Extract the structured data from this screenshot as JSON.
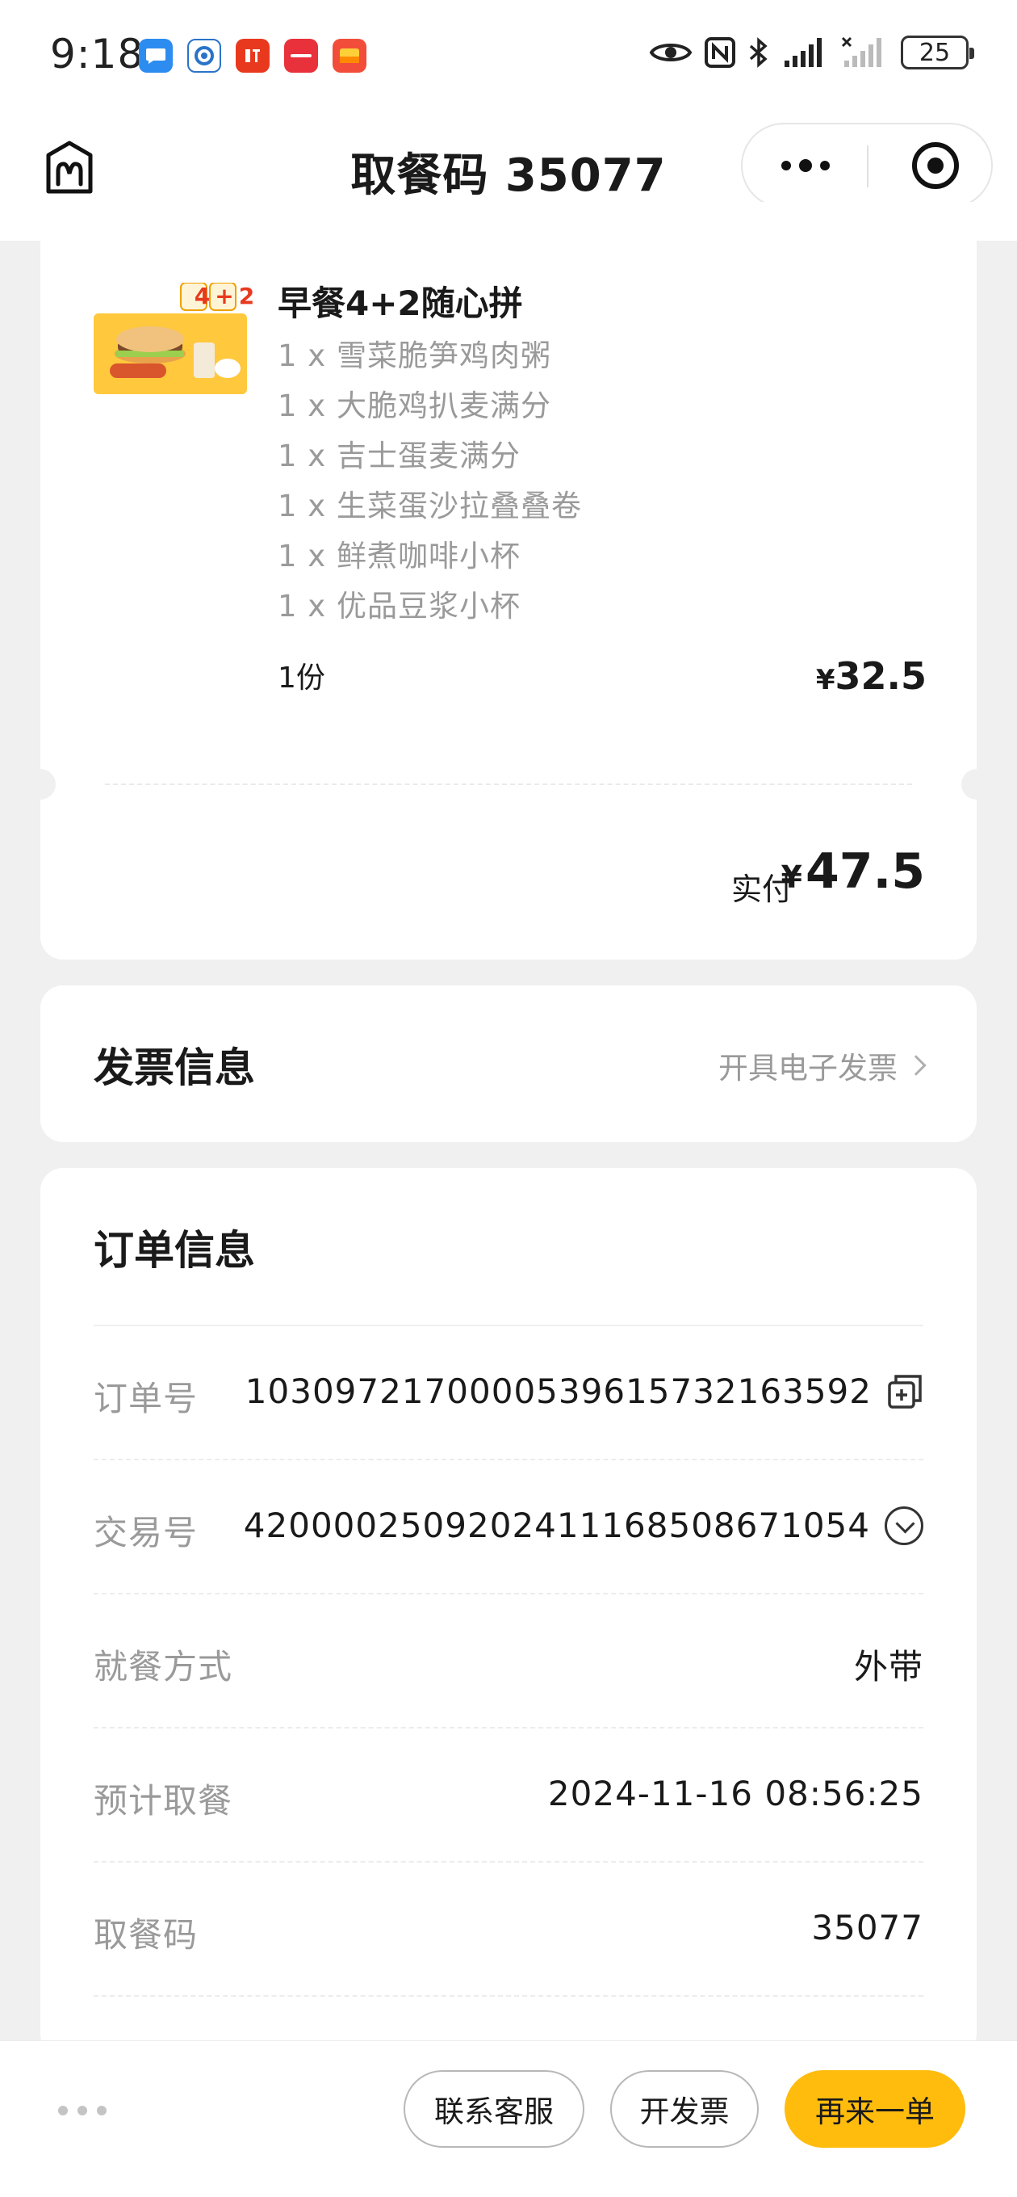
{
  "status_bar": {
    "time": "9:18",
    "battery": "25"
  },
  "nav": {
    "title": "取餐码 35077"
  },
  "item": {
    "name": "早餐4+2随心拼",
    "badge": "4+2",
    "sub_items": [
      "1 x 雪菜脆笋鸡肉粥",
      "1 x 大脆鸡扒麦满分",
      "1 x 吉士蛋麦满分",
      "1 x 生菜蛋沙拉叠叠卷",
      "1 x 鲜煮咖啡小杯",
      "1 x 优品豆浆小杯"
    ],
    "quantity": "1份",
    "currency": "¥",
    "price": "32.5"
  },
  "total": {
    "label": "实付",
    "currency": "¥",
    "amount": "47.5"
  },
  "invoice": {
    "title": "发票信息",
    "action": "开具电子发票"
  },
  "order_info": {
    "title": "订单信息",
    "rows": [
      {
        "label": "订单号",
        "value": "1030972170000539615732163592"
      },
      {
        "label": "交易号",
        "value": "4200002509202411168508671054"
      },
      {
        "label": "就餐方式",
        "value": "外带"
      },
      {
        "label": "预计取餐",
        "value": "2024-11-16 08:56:25"
      },
      {
        "label": "取餐码",
        "value": "35077"
      }
    ]
  },
  "bottom_bar": {
    "service_label": "联系客服",
    "invoice_label": "开发票",
    "reorder_label": "再来一单"
  },
  "colors": {
    "accent": "#ffbc0d",
    "background": "#f0f0f0",
    "muted_text": "#9a9a9a"
  }
}
